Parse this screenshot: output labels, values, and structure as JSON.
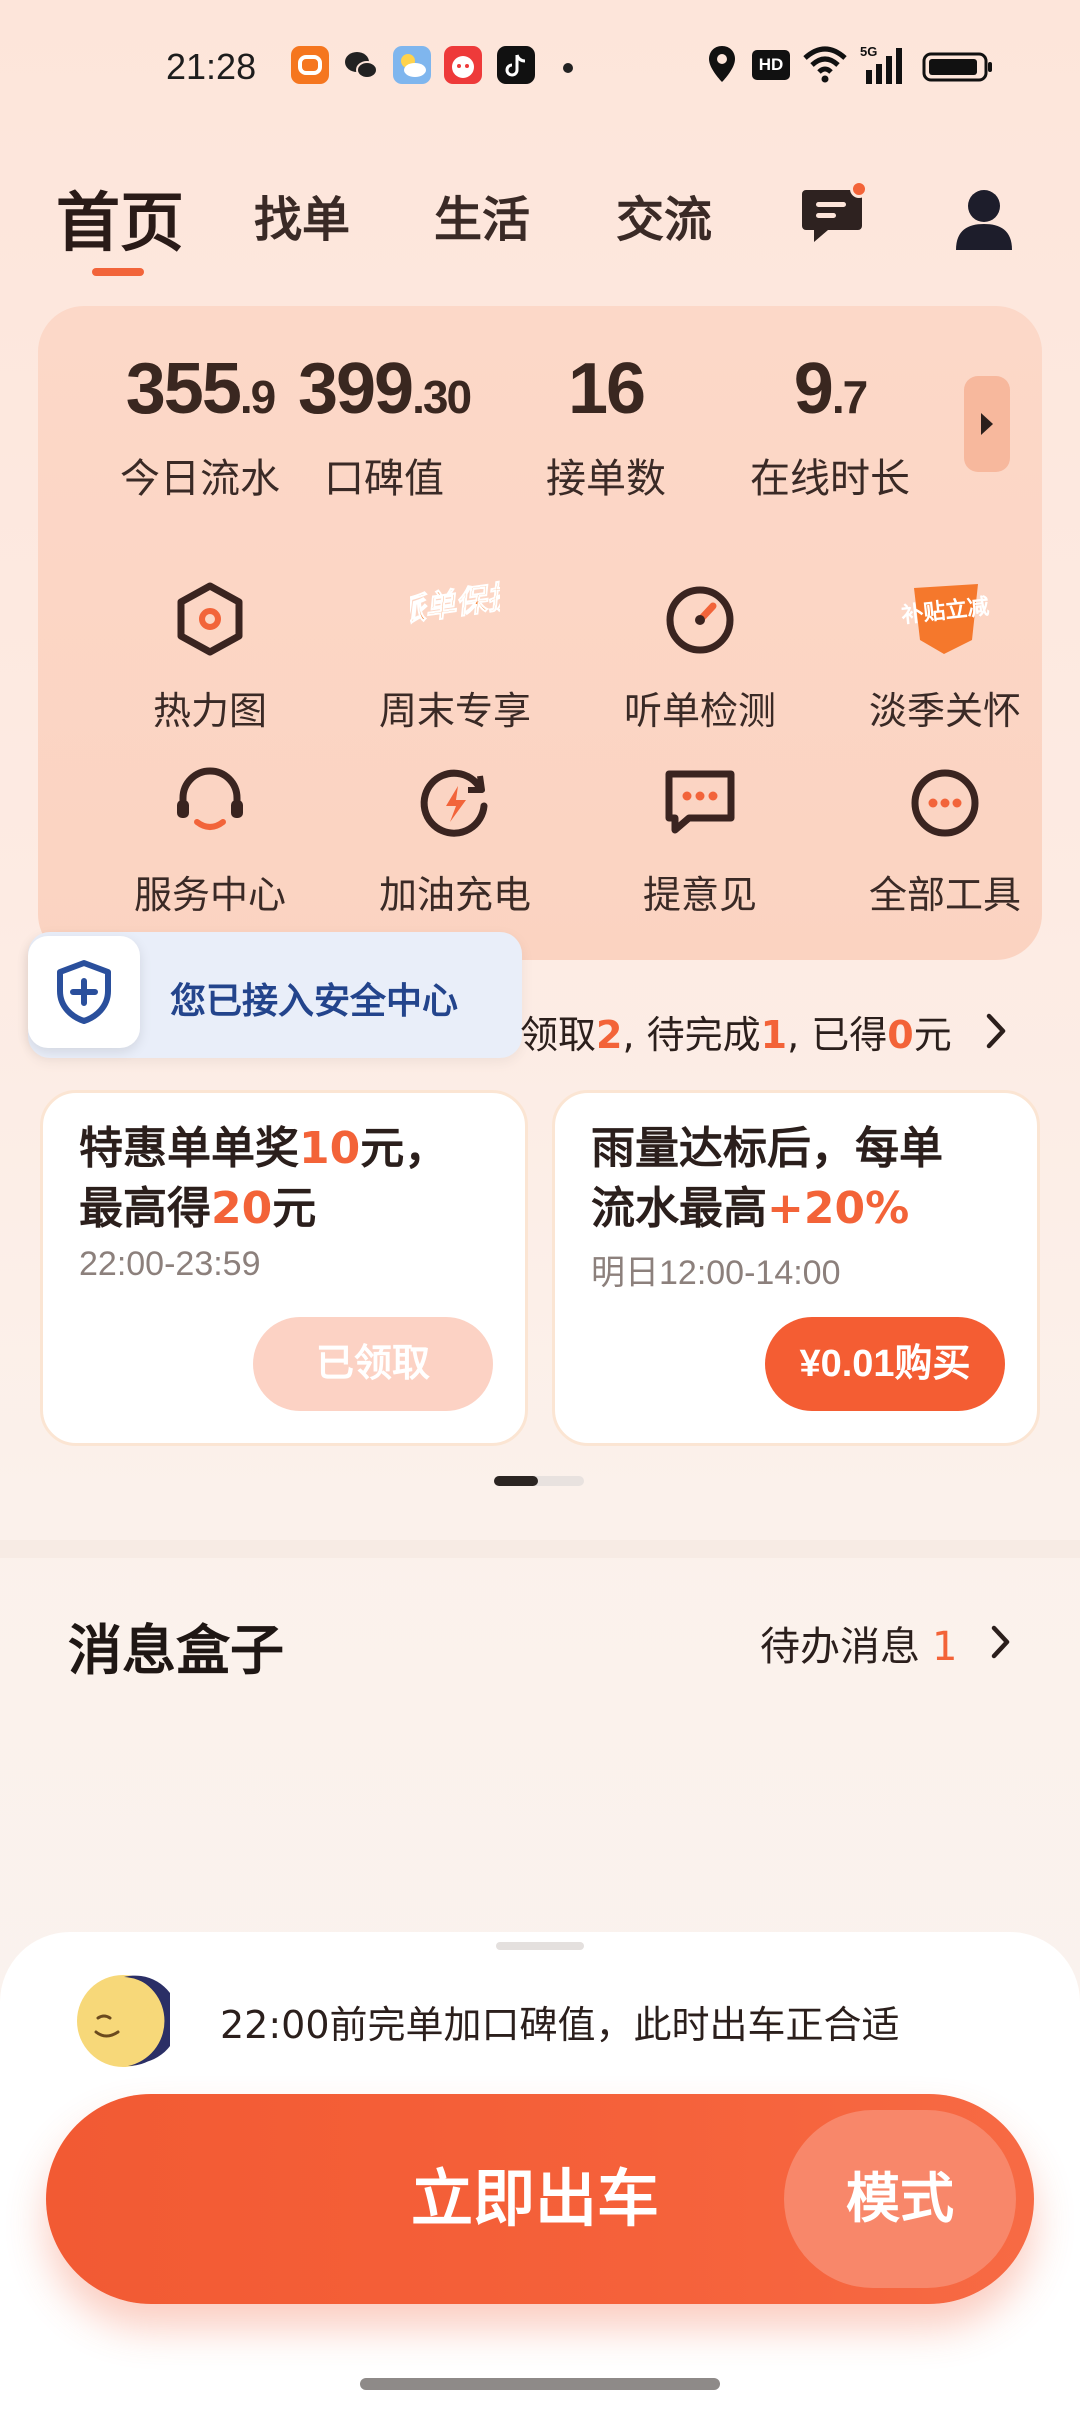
{
  "status_bar": {
    "time": "21:28",
    "network_badge": "HD",
    "signal_label": "5G"
  },
  "nav": {
    "tabs": [
      {
        "label": "首页",
        "active": true
      },
      {
        "label": "找单",
        "active": false
      },
      {
        "label": "生活",
        "active": false
      },
      {
        "label": "交流",
        "active": false
      }
    ],
    "message_icon": "chat-bubble-icon",
    "profile_icon": "user-icon"
  },
  "stats": [
    {
      "int": "355",
      "dec": ".9",
      "label": "今日流水"
    },
    {
      "int": "399",
      "dec": ".30",
      "label": "口碑值"
    },
    {
      "int": "16",
      "dec": "",
      "label": "接单数"
    },
    {
      "int": "9",
      "dec": ".7",
      "label": "在线时长"
    }
  ],
  "tools": [
    {
      "label": "热力图",
      "icon": "heatmap-hexagon-icon"
    },
    {
      "label": "周末专享",
      "icon": "dispatch-protection-badge-icon",
      "badge_text": "派单保护"
    },
    {
      "label": "听单检测",
      "icon": "gauge-icon"
    },
    {
      "label": "淡季关怀",
      "icon": "subsidy-badge-icon",
      "badge_text": "补贴立减"
    },
    {
      "label": "服务中心",
      "icon": "headset-icon"
    },
    {
      "label": "加油充电",
      "icon": "charge-icon"
    },
    {
      "label": "提意见",
      "icon": "feedback-icon"
    },
    {
      "label": "全部工具",
      "icon": "more-circle-icon"
    }
  ],
  "safety_toast": {
    "text": "您已接入安全中心",
    "icon": "shield-plus-icon"
  },
  "reward_summary": {
    "p1": "领取",
    "n1": "2",
    "p2": ", 待完成",
    "n2": "1",
    "p3": ", 已得",
    "n3": "0",
    "p4": "元"
  },
  "promos": [
    {
      "title_a": "特惠单单奖",
      "title_hl1": "10",
      "title_b": "元，",
      "title_c": "最高得",
      "title_hl2": "20",
      "title_d": "元",
      "time": "22:00-23:59",
      "button": "已领取"
    },
    {
      "title_a": "雨量达标后，每单",
      "title_c": "流水最高",
      "title_hl2": "+20%",
      "time": "明日12:00-14:00",
      "button": "¥0.01购买"
    }
  ],
  "message_box": {
    "title": "消息盒子",
    "todo_label": "待办消息",
    "todo_count": "1"
  },
  "bottom_sheet": {
    "tip": "22:00前完单加口碑值，此时出车正合适",
    "tip_icon": "moon-icon",
    "go_button": "立即出车",
    "mode_button": "模式"
  },
  "colors": {
    "accent": "#f45d33",
    "card_bg": "#fbd5c4",
    "safety_text": "#23448c"
  }
}
